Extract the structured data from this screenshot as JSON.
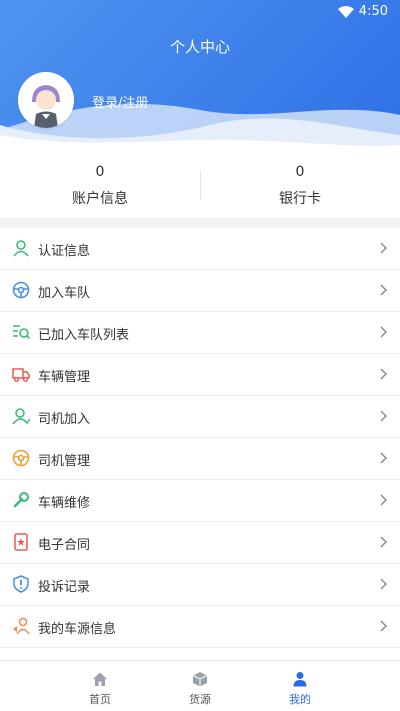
{
  "status_bar": {
    "time": "4:50"
  },
  "header": {
    "title": "个人中心",
    "login_text": "登录/注册"
  },
  "stats": [
    {
      "value": "0",
      "label": "账户信息"
    },
    {
      "value": "0",
      "label": "银行卡"
    }
  ],
  "menu": [
    {
      "label": "认证信息",
      "icon": "person-icon",
      "color": "#3cb878"
    },
    {
      "label": "加入车队",
      "icon": "steering-wheel-icon",
      "color": "#4a8de6"
    },
    {
      "label": "已加入车队列表",
      "icon": "list-search-icon",
      "color": "#3cb878"
    },
    {
      "label": "车辆管理",
      "icon": "truck-icon",
      "color": "#e85a4f"
    },
    {
      "label": "司机加入",
      "icon": "person-add-icon",
      "color": "#3cb878"
    },
    {
      "label": "司机管理",
      "icon": "steering-wheel-icon",
      "color": "#f0a030"
    },
    {
      "label": "车辆维修",
      "icon": "wrench-icon",
      "color": "#3cb878"
    },
    {
      "label": "电子合同",
      "icon": "contract-icon",
      "color": "#e85a4f"
    },
    {
      "label": "投诉记录",
      "icon": "shield-alert-icon",
      "color": "#4a8de6"
    },
    {
      "label": "我的车源信息",
      "icon": "vehicle-source-icon",
      "color": "#f08a50"
    },
    {
      "label": "",
      "icon": "settings-icon",
      "color": "#e85a4f"
    }
  ],
  "tabs": [
    {
      "label": "首页",
      "icon": "home-icon"
    },
    {
      "label": "货源",
      "icon": "cargo-icon"
    },
    {
      "label": "我的",
      "icon": "user-icon",
      "active": true
    }
  ],
  "colors": {
    "accent": "#2d6ae3",
    "header_start": "#4f95f0",
    "header_end": "#2f6fe6"
  }
}
